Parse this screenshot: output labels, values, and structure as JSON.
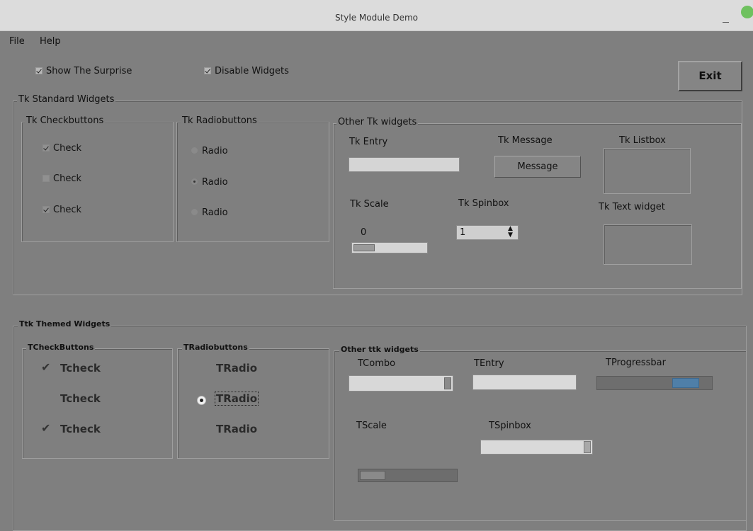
{
  "window": {
    "title": "Style Module Demo"
  },
  "menu": {
    "items": [
      "File",
      "Help"
    ]
  },
  "top": {
    "show_surprise": {
      "label": "Show The Surprise",
      "checked": true
    },
    "disable_widgets": {
      "label": "Disable Widgets",
      "checked": true
    },
    "exit_label": "Exit"
  },
  "tk": {
    "group_title": "Tk Standard Widgets",
    "checkbuttons": {
      "title": "Tk Checkbuttons",
      "items": [
        {
          "label": "Check",
          "checked": true
        },
        {
          "label": "Check",
          "checked": false
        },
        {
          "label": "Check",
          "checked": true
        }
      ]
    },
    "radiobuttons": {
      "title": "Tk Radiobuttons",
      "items": [
        {
          "label": "Radio",
          "selected": false
        },
        {
          "label": "Radio",
          "selected": true
        },
        {
          "label": "Radio",
          "selected": false
        }
      ]
    },
    "other": {
      "title": "Other Tk widgets",
      "entry_label": "Tk Entry",
      "entry_value": "",
      "message_label": "Tk Message",
      "message_text": "Message",
      "listbox_label": "Tk Listbox",
      "scale_label": "Tk Scale",
      "scale_value": "0",
      "spinbox_label": "Tk Spinbox",
      "spinbox_value": "1",
      "text_label": "Tk Text widget"
    }
  },
  "ttk": {
    "group_title": "Ttk Themed Widgets",
    "checkbuttons": {
      "title": "TCheckButtons",
      "items": [
        {
          "label": "Tcheck",
          "checked": true
        },
        {
          "label": "Tcheck",
          "checked": false
        },
        {
          "label": "Tcheck",
          "checked": true
        }
      ]
    },
    "radiobuttons": {
      "title": "TRadiobuttons",
      "items": [
        {
          "label": "TRadio",
          "selected": false
        },
        {
          "label": "TRadio",
          "selected": true
        },
        {
          "label": "TRadio",
          "selected": false
        }
      ]
    },
    "other": {
      "title": "Other ttk widgets",
      "combo_label": "TCombo",
      "combo_value": "",
      "entry_label": "TEntry",
      "entry_value": "",
      "progress_label": "TProgressbar",
      "scale_label": "TScale",
      "spinbox_label": "TSpinbox",
      "spinbox_value": ""
    }
  },
  "icons": {
    "check": "check-mark-icon",
    "radio": "radio-dot-icon"
  }
}
